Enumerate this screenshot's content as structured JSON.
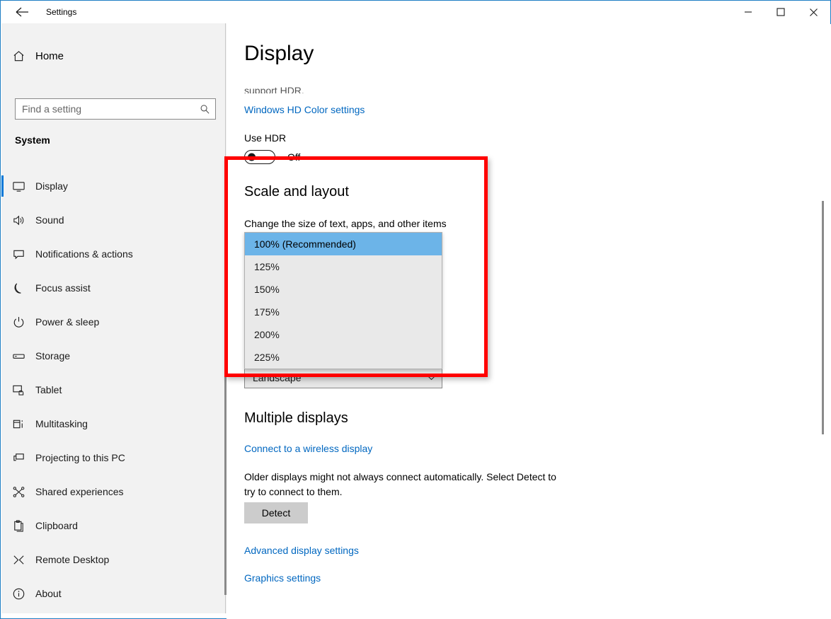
{
  "window": {
    "title": "Settings",
    "back_icon": "back-arrow-icon",
    "controls": {
      "minimize": "minimize-icon",
      "maximize": "maximize-icon",
      "close": "close-icon"
    },
    "accent_color": "#0078d7",
    "border_color": "#1f7fc4"
  },
  "sidebar": {
    "home_label": "Home",
    "home_icon": "home-icon",
    "search": {
      "placeholder": "Find a setting",
      "value": "",
      "icon": "search-icon"
    },
    "group_title": "System",
    "items": [
      {
        "label": "Display",
        "icon": "monitor-icon",
        "selected": true
      },
      {
        "label": "Sound",
        "icon": "speaker-icon",
        "selected": false
      },
      {
        "label": "Notifications & actions",
        "icon": "notification-icon",
        "selected": false
      },
      {
        "label": "Focus assist",
        "icon": "moon-icon",
        "selected": false
      },
      {
        "label": "Power & sleep",
        "icon": "power-icon",
        "selected": false
      },
      {
        "label": "Storage",
        "icon": "storage-icon",
        "selected": false
      },
      {
        "label": "Tablet",
        "icon": "tablet-icon",
        "selected": false
      },
      {
        "label": "Multitasking",
        "icon": "multitasking-icon",
        "selected": false
      },
      {
        "label": "Projecting to this PC",
        "icon": "projecting-icon",
        "selected": false
      },
      {
        "label": "Shared experiences",
        "icon": "share-icon",
        "selected": false
      },
      {
        "label": "Clipboard",
        "icon": "clipboard-icon",
        "selected": false
      },
      {
        "label": "Remote Desktop",
        "icon": "remote-desktop-icon",
        "selected": false
      },
      {
        "label": "About",
        "icon": "info-icon",
        "selected": false
      }
    ]
  },
  "main": {
    "page_title": "Display",
    "clipped_text": "support HDR.",
    "hd_color_link": "Windows HD Color settings",
    "use_hdr_label": "Use HDR",
    "hdr_toggle_state": "Off",
    "scale_section": {
      "heading": "Scale and layout",
      "subtitle": "Change the size of text, apps, and other items",
      "selected_value": "100% (Recommended)",
      "options": [
        "100% (Recommended)",
        "125%",
        "150%",
        "175%",
        "200%",
        "225%"
      ],
      "highlight_color": "#6cb4e8"
    },
    "orientation": {
      "value": "Landscape",
      "chevron_icon": "chevron-down-icon"
    },
    "multiple_displays": {
      "heading": "Multiple displays",
      "wireless_link": "Connect to a wireless display",
      "description": "Older displays might not always connect automatically. Select Detect to try to connect to them.",
      "detect_button": "Detect"
    },
    "advanced_link": "Advanced display settings",
    "graphics_link": "Graphics settings",
    "link_color": "#0067c0"
  },
  "annotation": {
    "highlight_box_color": "#ff0000"
  }
}
